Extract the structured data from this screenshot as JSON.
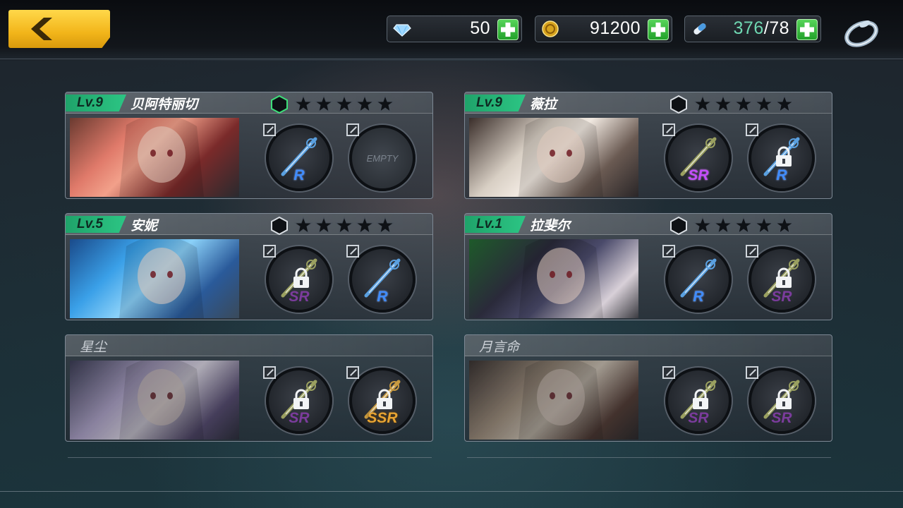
{
  "resources": {
    "diamonds": "50",
    "gold": "91200",
    "stamina_current": "376",
    "stamina_sep": "/",
    "stamina_max": "78"
  },
  "colors": {
    "accent": "#f2b51a",
    "level_badge": "#2cc584",
    "plus": "#22a12a"
  },
  "characters": [
    {
      "level": "Lv.9",
      "name": "贝阿特丽切",
      "unlocked": true,
      "stars": 5,
      "gem_active": true,
      "slots": [
        {
          "rarity": "R",
          "locked": false,
          "empty": false
        },
        {
          "rarity": "",
          "label": "EMPTY",
          "locked": false,
          "empty": true
        }
      ]
    },
    {
      "level": "Lv.9",
      "name": "薇拉",
      "unlocked": true,
      "stars": 5,
      "gem_active": false,
      "slots": [
        {
          "rarity": "SR",
          "locked": false,
          "empty": false
        },
        {
          "rarity": "R",
          "locked": true,
          "empty": false
        }
      ]
    },
    {
      "level": "Lv.5",
      "name": "安妮",
      "unlocked": true,
      "stars": 5,
      "gem_active": false,
      "slots": [
        {
          "rarity": "SR",
          "locked": true,
          "empty": false
        },
        {
          "rarity": "R",
          "locked": false,
          "empty": false
        }
      ]
    },
    {
      "level": "Lv.1",
      "name": "拉斐尔",
      "unlocked": true,
      "stars": 5,
      "gem_active": false,
      "slots": [
        {
          "rarity": "R",
          "locked": false,
          "empty": false
        },
        {
          "rarity": "SR",
          "locked": true,
          "empty": false
        }
      ]
    },
    {
      "level": "",
      "name": "星尘",
      "unlocked": false,
      "slots": [
        {
          "rarity": "SR",
          "locked": true,
          "empty": false
        },
        {
          "rarity": "SSR",
          "locked": true,
          "empty": false
        }
      ]
    },
    {
      "level": "",
      "name": "月言命",
      "unlocked": false,
      "slots": [
        {
          "rarity": "SR",
          "locked": true,
          "empty": false
        },
        {
          "rarity": "SR",
          "locked": true,
          "empty": false
        }
      ]
    }
  ]
}
